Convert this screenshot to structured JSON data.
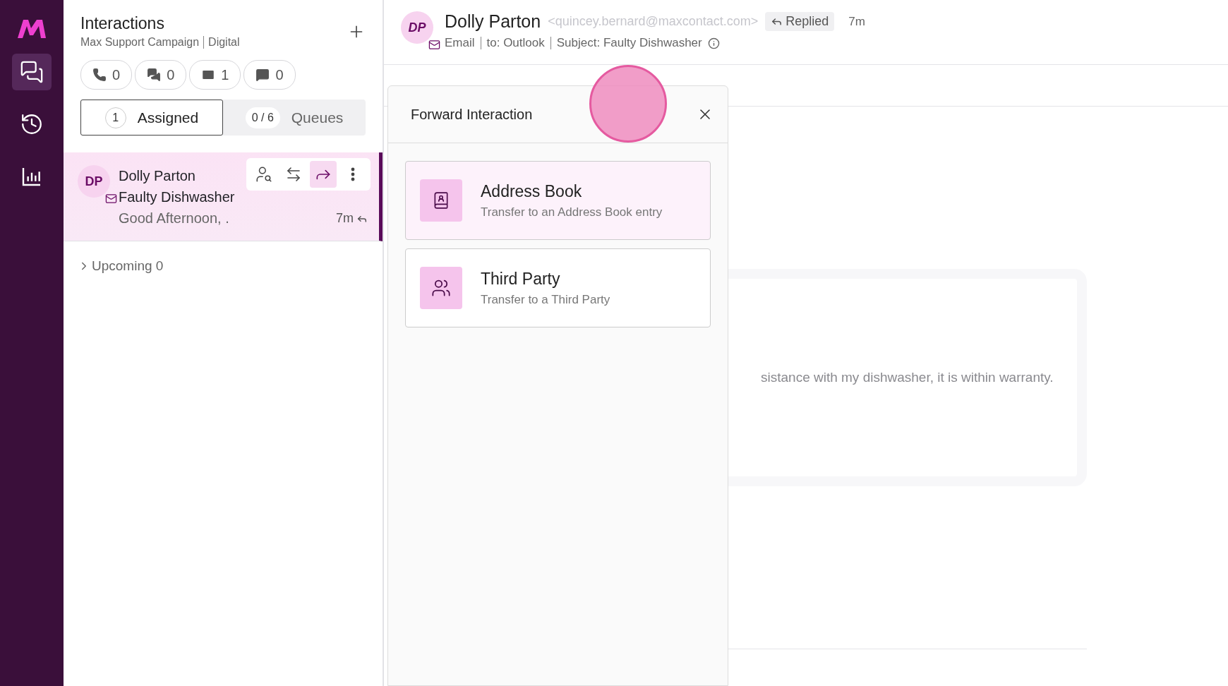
{
  "nav": {
    "items": [
      {
        "kind": "chats",
        "selected": true
      },
      {
        "kind": "history",
        "selected": false
      },
      {
        "kind": "reports",
        "selected": false
      }
    ]
  },
  "panel": {
    "title": "Interactions",
    "campaign": "Max Support Campaign",
    "channel": "Digital",
    "counters": [
      {
        "kind": "phone",
        "count": "0"
      },
      {
        "kind": "chat",
        "count": "0"
      },
      {
        "kind": "email",
        "count": "1"
      },
      {
        "kind": "sms",
        "count": "0"
      }
    ],
    "tabs": [
      {
        "badge": "1",
        "label": "Assigned",
        "selected": true
      },
      {
        "badge": "0 / 6",
        "label": "Queues",
        "selected": false
      }
    ],
    "interactions": [
      {
        "initials": "DP",
        "name": "Dolly Parton",
        "subject": "Faulty Dishwasher",
        "preview": "Good Afternoon, .",
        "time": "7m",
        "selected": true
      }
    ],
    "upcoming": {
      "label": "Upcoming 0",
      "expanded": false
    }
  },
  "conversation": {
    "initials": "DP",
    "name": "Dolly Parton",
    "email": "<quincey.bernard@maxcontact.com>",
    "status": "Replied",
    "time": "7m",
    "channel": "Email",
    "to": "to: Outlook",
    "subject": "Subject: Faulty Dishwasher",
    "message": "sistance with my dishwasher, it is within warranty."
  },
  "modal": {
    "title": "Forward Interaction",
    "options": [
      {
        "kind": "address_book",
        "title": "Address Book",
        "description": "Transfer to an Address Book entry",
        "highlighted": true
      },
      {
        "kind": "third_party",
        "title": "Third Party",
        "description": "Transfer to a Third Party",
        "highlighted": false
      }
    ]
  }
}
